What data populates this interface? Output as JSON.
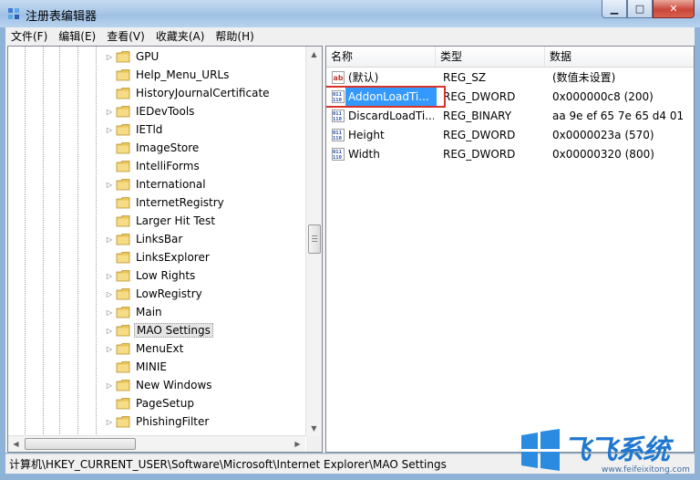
{
  "window": {
    "title": "注册表编辑器",
    "buttons": {
      "minimize": "▁",
      "maximize": "□",
      "close": "✕"
    }
  },
  "menu": [
    "文件(F)",
    "编辑(E)",
    "查看(V)",
    "收藏夹(A)",
    "帮助(H)"
  ],
  "tree": {
    "items": [
      {
        "label": "GPU",
        "expandable": true
      },
      {
        "label": "Help_Menu_URLs",
        "expandable": false
      },
      {
        "label": "HistoryJournalCertificate",
        "expandable": false
      },
      {
        "label": "IEDevTools",
        "expandable": true
      },
      {
        "label": "IETld",
        "expandable": true
      },
      {
        "label": "ImageStore",
        "expandable": false
      },
      {
        "label": "IntelliForms",
        "expandable": false
      },
      {
        "label": "International",
        "expandable": true
      },
      {
        "label": "InternetRegistry",
        "expandable": false
      },
      {
        "label": "Larger Hit Test",
        "expandable": false
      },
      {
        "label": "LinksBar",
        "expandable": true
      },
      {
        "label": "LinksExplorer",
        "expandable": false
      },
      {
        "label": "Low Rights",
        "expandable": true
      },
      {
        "label": "LowRegistry",
        "expandable": true
      },
      {
        "label": "Main",
        "expandable": true
      },
      {
        "label": "MAO Settings",
        "expandable": true,
        "selected": true
      },
      {
        "label": "MenuExt",
        "expandable": true
      },
      {
        "label": "MINIE",
        "expandable": false
      },
      {
        "label": "New Windows",
        "expandable": true
      },
      {
        "label": "PageSetup",
        "expandable": false
      },
      {
        "label": "PhishingFilter",
        "expandable": true
      }
    ]
  },
  "list": {
    "columns": [
      "名称",
      "类型",
      "数据"
    ],
    "rows": [
      {
        "name": "(默认)",
        "type": "REG_SZ",
        "data": "(数值未设置)",
        "icon": "string-value-icon"
      },
      {
        "name": "AddonLoadTi...",
        "type": "REG_DWORD",
        "data": "0x000000c8 (200)",
        "icon": "binary-value-icon",
        "selected": true
      },
      {
        "name": "DiscardLoadTi...",
        "type": "REG_BINARY",
        "data": "aa 9e ef 65 7e 65 d4 01",
        "icon": "binary-value-icon"
      },
      {
        "name": "Height",
        "type": "REG_DWORD",
        "data": "0x0000023a (570)",
        "icon": "binary-value-icon"
      },
      {
        "name": "Width",
        "type": "REG_DWORD",
        "data": "0x00000320 (800)",
        "icon": "binary-value-icon"
      }
    ]
  },
  "status": "计算机\\HKEY_CURRENT_USER\\Software\\Microsoft\\Internet Explorer\\MAO Settings",
  "watermark": {
    "text": "飞飞系统",
    "url": "www.feifeixitong.com"
  },
  "colors": {
    "selection": "#3399ff",
    "highlight_box": "#d9322b",
    "folder": "#e9c45a"
  }
}
